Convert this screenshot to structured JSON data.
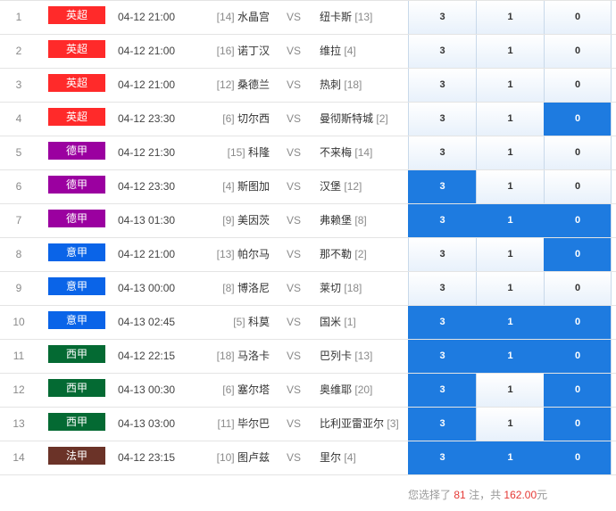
{
  "colors": {
    "league": {
      "英超": "#ff2a2a",
      "德甲": "#9b00a0",
      "意甲": "#0a64e8",
      "西甲": "#046a33",
      "法甲": "#6b3328"
    },
    "selected": "#1e7be0",
    "highlight": "#e53935"
  },
  "vs_label": "VS",
  "rows": [
    {
      "no": "1",
      "league": "英超",
      "time": "04-12 21:00",
      "home_rank": "[14]",
      "home": "水晶宫",
      "away": "纽卡斯",
      "away_rank": "[13]",
      "odds": [
        "3",
        "1",
        "0"
      ],
      "selected": [
        false,
        false,
        false
      ]
    },
    {
      "no": "2",
      "league": "英超",
      "time": "04-12 21:00",
      "home_rank": "[16]",
      "home": "诺丁汉",
      "away": "维拉",
      "away_rank": "[4]",
      "odds": [
        "3",
        "1",
        "0"
      ],
      "selected": [
        false,
        false,
        false
      ]
    },
    {
      "no": "3",
      "league": "英超",
      "time": "04-12 21:00",
      "home_rank": "[12]",
      "home": "桑德兰",
      "away": "热刺",
      "away_rank": "[18]",
      "odds": [
        "3",
        "1",
        "0"
      ],
      "selected": [
        false,
        false,
        false
      ]
    },
    {
      "no": "4",
      "league": "英超",
      "time": "04-12 23:30",
      "home_rank": "[6]",
      "home": "切尔西",
      "away": "曼彻斯特城",
      "away_rank": "[2]",
      "odds": [
        "3",
        "1",
        "0"
      ],
      "selected": [
        false,
        false,
        true
      ]
    },
    {
      "no": "5",
      "league": "德甲",
      "time": "04-12 21:30",
      "home_rank": "[15]",
      "home": "科隆",
      "away": "不来梅",
      "away_rank": "[14]",
      "odds": [
        "3",
        "1",
        "0"
      ],
      "selected": [
        false,
        false,
        false
      ]
    },
    {
      "no": "6",
      "league": "德甲",
      "time": "04-12 23:30",
      "home_rank": "[4]",
      "home": "斯图加",
      "away": "汉堡",
      "away_rank": "[12]",
      "odds": [
        "3",
        "1",
        "0"
      ],
      "selected": [
        true,
        false,
        false
      ]
    },
    {
      "no": "7",
      "league": "德甲",
      "time": "04-13 01:30",
      "home_rank": "[9]",
      "home": "美因茨",
      "away": "弗赖堡",
      "away_rank": "[8]",
      "odds": [
        "3",
        "1",
        "0"
      ],
      "selected": [
        true,
        true,
        true
      ]
    },
    {
      "no": "8",
      "league": "意甲",
      "time": "04-12 21:00",
      "home_rank": "[13]",
      "home": "帕尔马",
      "away": "那不勒",
      "away_rank": "[2]",
      "odds": [
        "3",
        "1",
        "0"
      ],
      "selected": [
        false,
        false,
        true
      ]
    },
    {
      "no": "9",
      "league": "意甲",
      "time": "04-13 00:00",
      "home_rank": "[8]",
      "home": "博洛尼",
      "away": "莱切",
      "away_rank": "[18]",
      "odds": [
        "3",
        "1",
        "0"
      ],
      "selected": [
        false,
        false,
        false
      ]
    },
    {
      "no": "10",
      "league": "意甲",
      "time": "04-13 02:45",
      "home_rank": "[5]",
      "home": "科莫",
      "away": "国米",
      "away_rank": "[1]",
      "odds": [
        "3",
        "1",
        "0"
      ],
      "selected": [
        true,
        true,
        true
      ]
    },
    {
      "no": "11",
      "league": "西甲",
      "time": "04-12 22:15",
      "home_rank": "[18]",
      "home": "马洛卡",
      "away": "巴列卡",
      "away_rank": "[13]",
      "odds": [
        "3",
        "1",
        "0"
      ],
      "selected": [
        true,
        true,
        true
      ]
    },
    {
      "no": "12",
      "league": "西甲",
      "time": "04-13 00:30",
      "home_rank": "[6]",
      "home": "塞尔塔",
      "away": "奥维耶",
      "away_rank": "[20]",
      "odds": [
        "3",
        "1",
        "0"
      ],
      "selected": [
        true,
        false,
        true
      ]
    },
    {
      "no": "13",
      "league": "西甲",
      "time": "04-13 03:00",
      "home_rank": "[11]",
      "home": "毕尔巴",
      "away": "比利亚雷亚尔",
      "away_rank": "[3]",
      "odds": [
        "3",
        "1",
        "0"
      ],
      "selected": [
        true,
        false,
        true
      ]
    },
    {
      "no": "14",
      "league": "法甲",
      "time": "04-12 23:15",
      "home_rank": "[10]",
      "home": "图卢兹",
      "away": "里尔",
      "away_rank": "[4]",
      "odds": [
        "3",
        "1",
        "0"
      ],
      "selected": [
        true,
        true,
        true
      ]
    }
  ],
  "summary": {
    "prefix": "您选择了",
    "count": "81",
    "middle": "注，共",
    "amount": "162.00",
    "suffix": "元"
  }
}
